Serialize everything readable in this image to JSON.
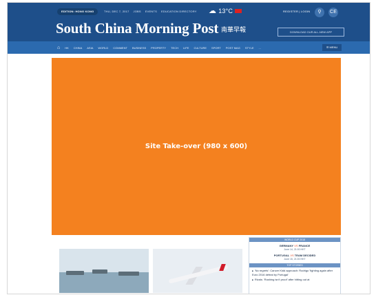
{
  "header": {
    "edition_label": "EDITION: HONG KONG",
    "top_links": [
      "THU, DEC 7, 2017",
      "JOBS",
      "EVENTS",
      "EDUCATION DIRECTORY"
    ],
    "weather_temp": "13°C",
    "account_label": "REGISTER | LOGIN",
    "search_icon": "search-icon",
    "ce_label": "CE",
    "masthead": "South China Morning Post",
    "masthead_chinese": "南華早報",
    "app_button": "DOWNLOAD OUR ALL-NEW APP",
    "nav_items": [
      "HK",
      "CHINA",
      "ASIA",
      "WORLD",
      "COMMENT",
      "BUSINESS",
      "PROPERTY",
      "TECH",
      "LIFE",
      "CULTURE",
      "SPORT",
      "POST MAG",
      "STYLE",
      "..."
    ],
    "menu_label": "MENU",
    "colors": {
      "brand": "#1e4f8a",
      "nav": "#2b6aaf"
    }
  },
  "takeover": {
    "label": "Site Take-over (980 x 600)",
    "color": "#f4811f"
  },
  "sidebar": {
    "header1": "WORLD CUP 2018",
    "matches": [
      {
        "home": "GERMANY",
        "away": "FRANCE",
        "vs": "VS",
        "time": "June 14, 21:00 HKT"
      },
      {
        "home": "PORTUGAL",
        "away": "TEAM DECIDED",
        "vs": "VS",
        "time": "June 15, 21:00 HKT"
      }
    ],
    "header2": "TOP STORIES",
    "stories": [
      "'No regrets': Cancer Kidd approach: Rodrigo 'fighting again after Euro 2016 defeat by Portugal'",
      "Rivals: 'Rushing isn't proof' after hitting out at"
    ]
  }
}
